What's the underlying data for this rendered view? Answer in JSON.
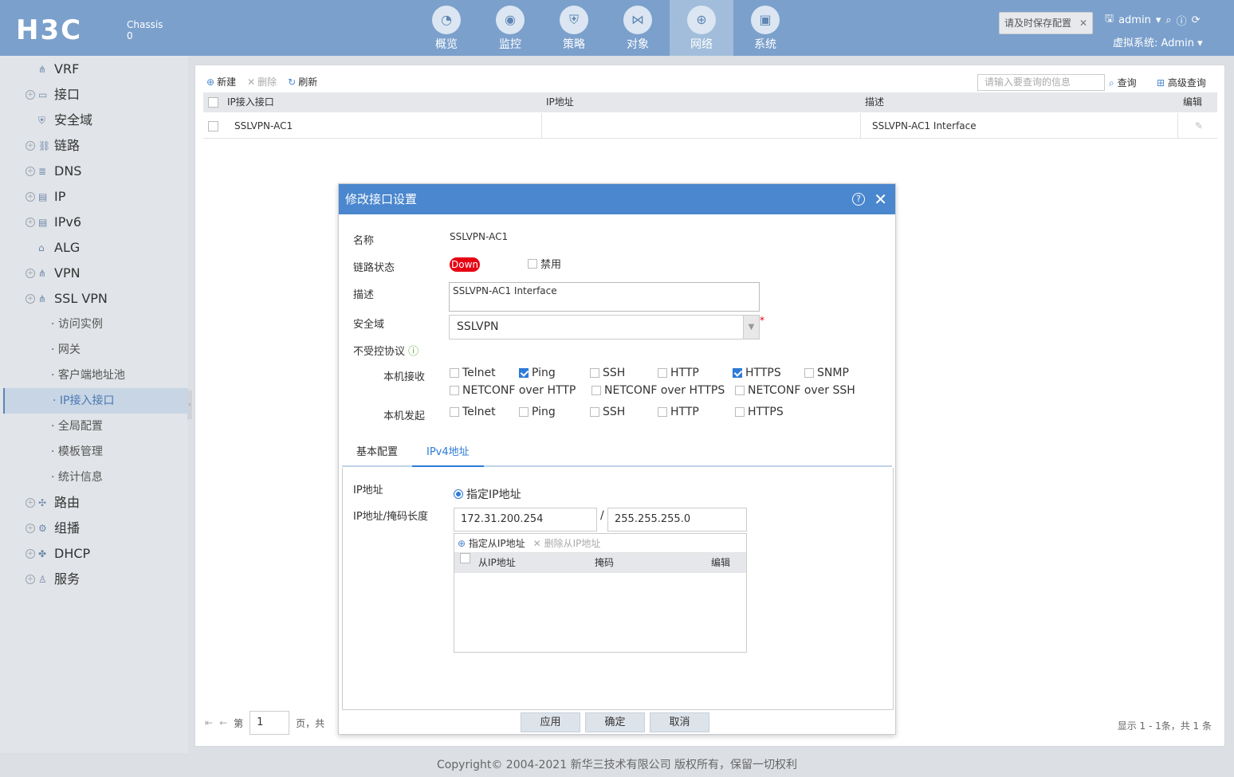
{
  "header": {
    "logo": "H3C",
    "chassis_label": "Chassis",
    "chassis_num": "0",
    "nav": [
      {
        "label": "概览",
        "icon": "gauge-icon",
        "glyph": "◔"
      },
      {
        "label": "监控",
        "icon": "camera-icon",
        "glyph": "◉"
      },
      {
        "label": "策略",
        "icon": "shield-icon",
        "glyph": "⛨"
      },
      {
        "label": "对象",
        "icon": "share-icon",
        "glyph": "⋈"
      },
      {
        "label": "网络",
        "icon": "globe-icon",
        "glyph": "⊕",
        "active": true
      },
      {
        "label": "系统",
        "icon": "monitor-icon",
        "glyph": "▣"
      }
    ],
    "save_tip": "请及时保存配置",
    "user": "admin",
    "vsys": "虚拟系统: Admin"
  },
  "sidebar": {
    "items": [
      {
        "label": "VRF",
        "type": "top",
        "expand": false
      },
      {
        "label": "接口",
        "type": "top",
        "expand": true
      },
      {
        "label": "安全域",
        "type": "top",
        "expand": false
      },
      {
        "label": "链路",
        "type": "top",
        "expand": true
      },
      {
        "label": "DNS",
        "type": "top",
        "expand": true
      },
      {
        "label": "IP",
        "type": "top",
        "expand": true
      },
      {
        "label": "IPv6",
        "type": "top",
        "expand": true
      },
      {
        "label": "ALG",
        "type": "top",
        "expand": false
      },
      {
        "label": "VPN",
        "type": "top",
        "expand": true
      },
      {
        "label": "SSL VPN",
        "type": "top",
        "expand": true
      },
      {
        "label": "· 访问实例",
        "type": "sub"
      },
      {
        "label": "· 网关",
        "type": "sub"
      },
      {
        "label": "· 客户端地址池",
        "type": "sub"
      },
      {
        "label": "· IP接入接口",
        "type": "sub",
        "selected": true
      },
      {
        "label": "· 全局配置",
        "type": "sub"
      },
      {
        "label": "· 模板管理",
        "type": "sub"
      },
      {
        "label": "· 统计信息",
        "type": "sub"
      },
      {
        "label": "路由",
        "type": "top",
        "expand": true
      },
      {
        "label": "组播",
        "type": "top",
        "expand": true
      },
      {
        "label": "DHCP",
        "type": "top",
        "expand": true
      },
      {
        "label": "服务",
        "type": "top",
        "expand": true
      }
    ]
  },
  "toolbar": {
    "new": "新建",
    "delete": "删除",
    "refresh": "刷新",
    "search_placeholder": "请输入要查询的信息",
    "query": "查询",
    "advanced": "高级查询"
  },
  "table": {
    "headers": [
      "IP接入接口",
      "IP地址",
      "描述",
      "编辑"
    ],
    "rows": [
      [
        "SSLVPN-AC1",
        "",
        "SSLVPN-AC1 Interface"
      ]
    ]
  },
  "pager": {
    "page_prefix": "第",
    "page": "1",
    "page_suffix": "页，共",
    "count": "显示 1 - 1条，共 1 条"
  },
  "footer": "Copyright© 2004-2021 新华三技术有限公司 版权所有，保留一切权利",
  "dialog": {
    "title": "修改接口设置",
    "name_label": "名称",
    "name_value": "SSLVPN-AC1",
    "link_label": "链路状态",
    "link_status": "Down",
    "disable_label": "禁用",
    "desc_label": "描述",
    "desc_value": "SSLVPN-AC1 Interface",
    "zone_label": "安全域",
    "zone_value": "SSLVPN",
    "proto_label": "不受控协议",
    "recv_label": "本机接收",
    "send_label": "本机发起",
    "recv": [
      {
        "l": "Telnet",
        "c": false
      },
      {
        "l": "Ping",
        "c": true
      },
      {
        "l": "SSH",
        "c": false
      },
      {
        "l": "HTTP",
        "c": false
      },
      {
        "l": "HTTPS",
        "c": true
      },
      {
        "l": "SNMP",
        "c": false
      },
      {
        "l": "NETCONF over HTTP",
        "c": false
      },
      {
        "l": "NETCONF over HTTPS",
        "c": false
      },
      {
        "l": "NETCONF over SSH",
        "c": false
      }
    ],
    "send": [
      {
        "l": "Telnet",
        "c": false
      },
      {
        "l": "Ping",
        "c": false
      },
      {
        "l": "SSH",
        "c": false
      },
      {
        "l": "HTTP",
        "c": false
      },
      {
        "l": "HTTPS",
        "c": false
      }
    ],
    "tabs": [
      "基本配置",
      "IPv4地址"
    ],
    "ip_label": "IP地址",
    "ip_radio": "指定IP地址",
    "ipmask_label": "IP地址/掩码长度",
    "ip": "172.31.200.254",
    "mask": "255.255.255.0",
    "add_sub": "指定从IP地址",
    "del_sub": "删除从IP地址",
    "sub_headers": [
      "从IP地址",
      "掩码",
      "编辑"
    ],
    "buttons": [
      "应用",
      "确定",
      "取消"
    ]
  },
  "colors": {
    "header": "#7ba0cc",
    "dialog_title": "#4a87ce",
    "down": "#e60012"
  }
}
